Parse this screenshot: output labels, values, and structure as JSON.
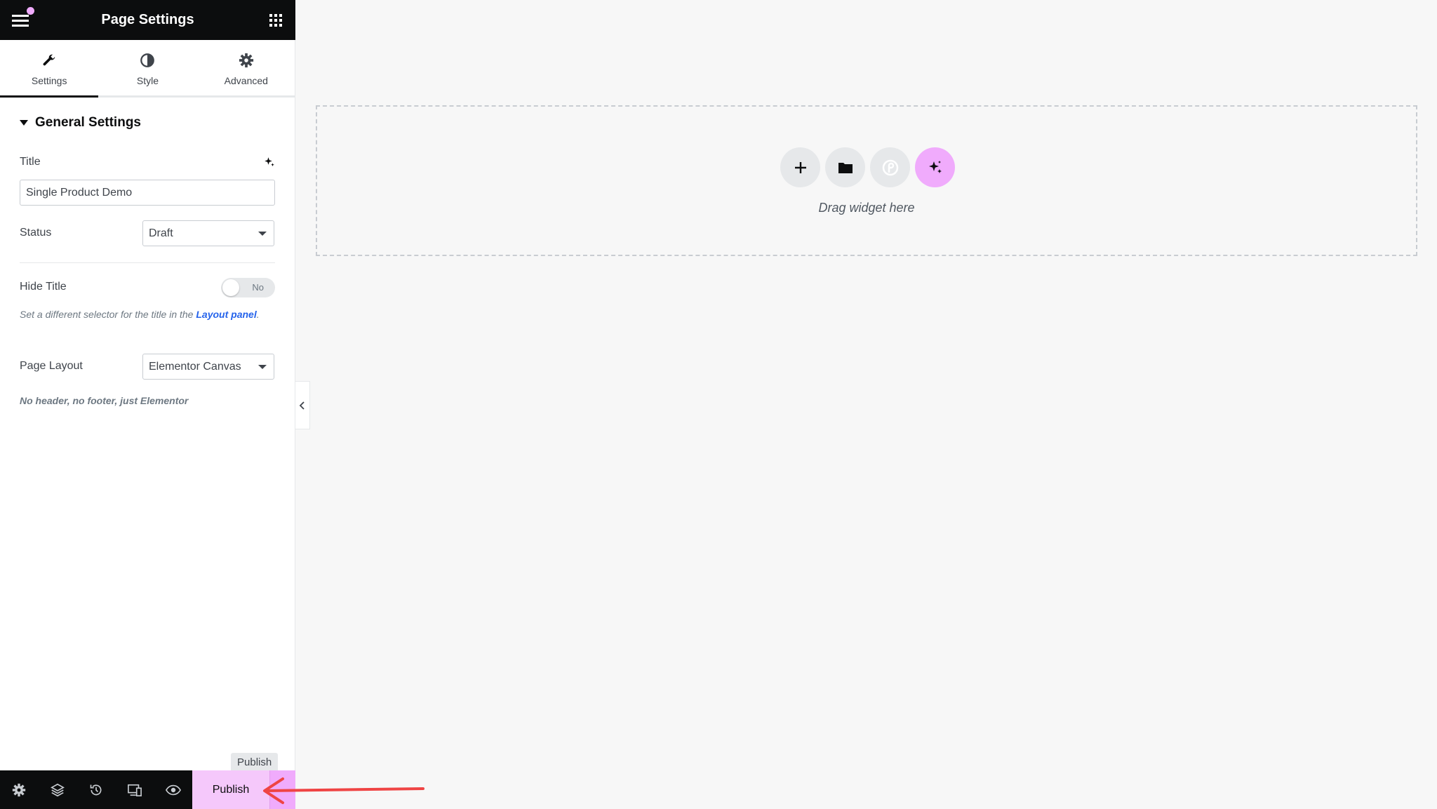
{
  "panel": {
    "title": "Page Settings",
    "tabs": [
      {
        "label": "Settings",
        "icon": "wrench-icon"
      },
      {
        "label": "Style",
        "icon": "half-circle-icon"
      },
      {
        "label": "Advanced",
        "icon": "gear-icon"
      }
    ],
    "section_title": "General Settings",
    "fields": {
      "title_label": "Title",
      "title_value": "Single Product Demo",
      "status_label": "Status",
      "status_value": "Draft",
      "hide_title_label": "Hide Title",
      "hide_title_value": "No",
      "help_text": "Set a different selector for the title in the",
      "help_link": "Layout panel",
      "page_layout_label": "Page Layout",
      "page_layout_value": "Elementor Canvas",
      "page_layout_desc": "No header, no footer, just Elementor"
    }
  },
  "bottom_bar": {
    "publish_label": "Publish",
    "tooltip": "Publish"
  },
  "canvas": {
    "drag_text": "Drag widget here"
  },
  "colors": {
    "accent": "#f0abfc",
    "dark": "#0c0d0e",
    "annotation": "#ef4444"
  }
}
